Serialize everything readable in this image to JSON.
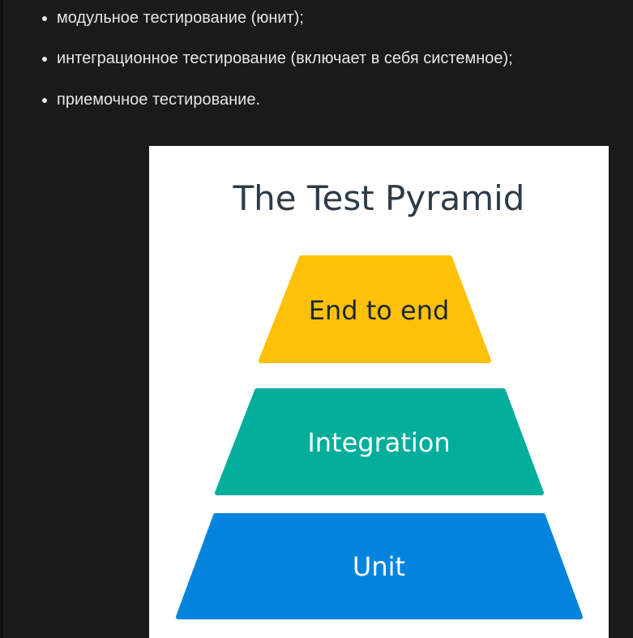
{
  "bullets": [
    "модульное тестирование (юнит);",
    "интеграционное тестирование (включает в себя системное);",
    "приемочное тестирование."
  ],
  "pyramid": {
    "title": "The Test Pyramid",
    "tiers": [
      {
        "label": "End to end",
        "color": "#fdc107"
      },
      {
        "label": "Integration",
        "color": "#00ae9b"
      },
      {
        "label": "Unit",
        "color": "#0284dc"
      }
    ]
  },
  "colors": {
    "page_background": "#1a1a1a",
    "text": "#e6e6e6",
    "panel_background": "#ffffff",
    "title": "#2d3b48"
  }
}
